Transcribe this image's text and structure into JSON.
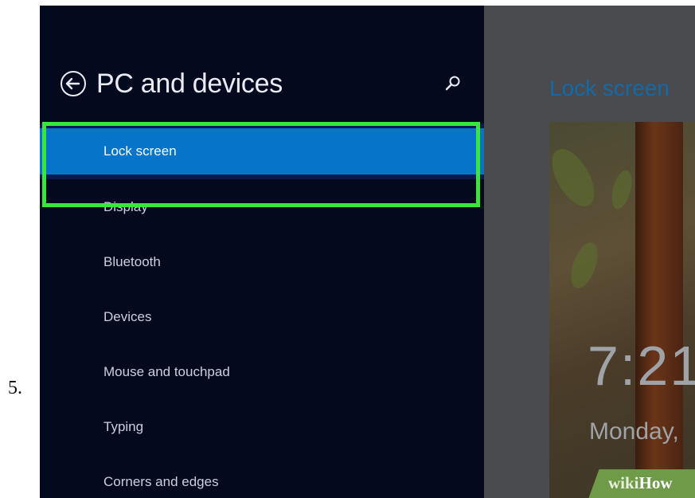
{
  "step_number": "5.",
  "header": {
    "title": "PC and devices",
    "back_icon": "back-arrow-circle-icon",
    "search_icon": "search-icon"
  },
  "nav": {
    "items": [
      {
        "label": "Lock screen",
        "selected": true
      },
      {
        "label": "Display"
      },
      {
        "label": "Bluetooth"
      },
      {
        "label": "Devices"
      },
      {
        "label": "Mouse and touchpad"
      },
      {
        "label": "Typing"
      },
      {
        "label": "Corners and edges"
      }
    ]
  },
  "content": {
    "title": "Lock screen",
    "preview_time": "7:21",
    "preview_date": "Monday,",
    "watermark": {
      "wiki": "wiki",
      "how": "How"
    }
  },
  "colors": {
    "selected_bg": "#0674c9",
    "highlight": "#39e63c",
    "sidebar_bg": "#040a1e"
  }
}
